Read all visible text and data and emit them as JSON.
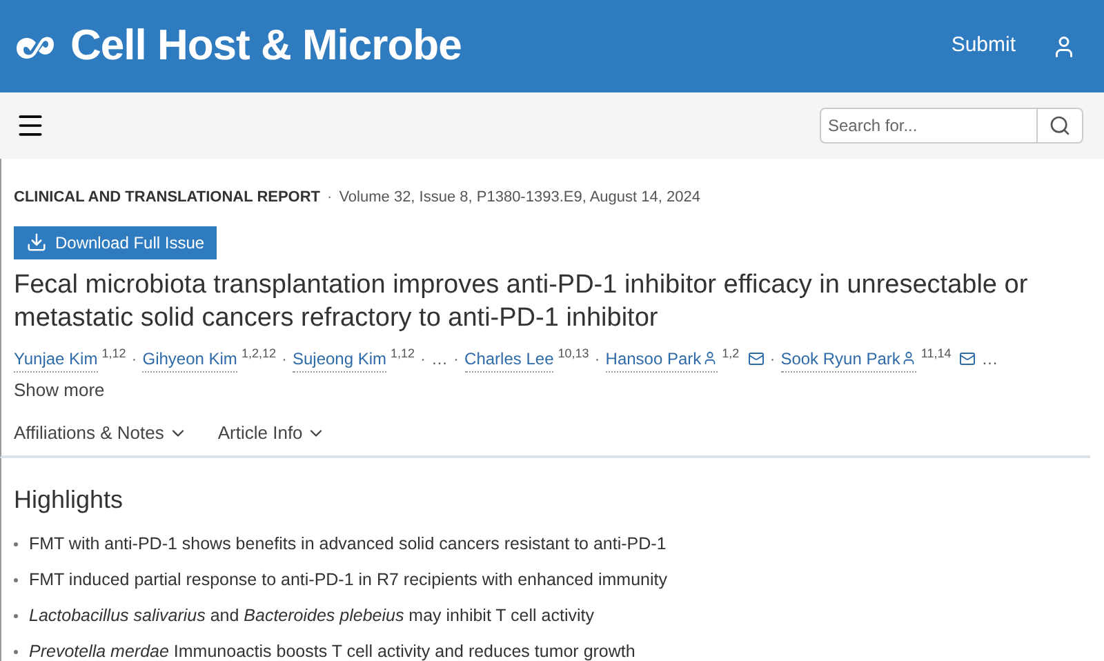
{
  "header": {
    "journal": "Cell Host & Microbe",
    "submit": "Submit"
  },
  "search": {
    "placeholder": "Search for..."
  },
  "article": {
    "type": "CLINICAL AND TRANSLATIONAL REPORT",
    "separator": "·",
    "citation": "Volume 32, Issue 8, P1380-1393.E9, August 14, 2024",
    "download": "Download Full Issue",
    "title": "Fecal microbiota transplantation improves anti-PD-1 inhibitor efficacy in unresectable or metastatic solid cancers refractory to anti-PD-1 inhibitor",
    "authors": [
      {
        "kind": "author",
        "name": "Yunjae Kim",
        "sup": "1,12",
        "corresponding": false
      },
      {
        "kind": "author",
        "name": "Gihyeon Kim",
        "sup": "1,2,12",
        "corresponding": false
      },
      {
        "kind": "author",
        "name": "Sujeong Kim",
        "sup": "1,12",
        "corresponding": false
      },
      {
        "kind": "ellipsis",
        "name": "…"
      },
      {
        "kind": "author",
        "name": "Charles Lee",
        "sup": "10,13",
        "corresponding": false
      },
      {
        "kind": "author",
        "name": "Hansoo Park",
        "sup": "1,2",
        "corresponding": true
      },
      {
        "kind": "author",
        "name": "Sook Ryun Park",
        "sup": "11,14",
        "corresponding": true
      }
    ],
    "authors_trailing": "…",
    "show_more": "Show more",
    "tabs": [
      {
        "label": "Affiliations & Notes",
        "expanded": false
      },
      {
        "label": "Article Info",
        "expanded": false
      }
    ]
  },
  "highlights": {
    "heading": "Highlights",
    "items": [
      "FMT with anti-PD-1 shows benefits in advanced solid cancers resistant to anti-PD-1",
      "FMT induced partial response to anti-PD-1 in R7 recipients with enhanced immunity",
      "*Lactobacillus salivarius* and *Bacteroides plebeius* may inhibit T cell activity",
      "*Prevotella merdae* Immunoactis boosts T cell activity and reduces tumor growth"
    ]
  }
}
